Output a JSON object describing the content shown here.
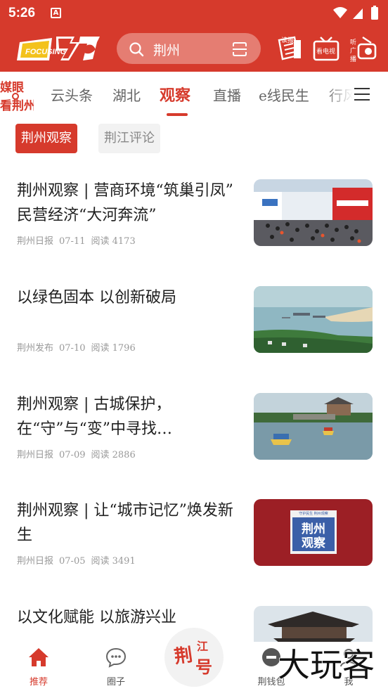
{
  "status_bar": {
    "time": "5:26",
    "app_badge": "A"
  },
  "header": {
    "logo_text": "FOCUSING",
    "search": {
      "value": "荆州"
    },
    "icons": [
      {
        "name": "newspaper-icon",
        "label": "读报"
      },
      {
        "name": "tv-icon",
        "label": "看电视"
      },
      {
        "name": "radio-icon",
        "label": "听广播"
      }
    ]
  },
  "channels": {
    "badge": "媒眼看荆州",
    "tabs": [
      "云头条",
      "湖北",
      "观察",
      "直播",
      "e线民生",
      "行风"
    ],
    "active_index": 2
  },
  "subtabs": [
    "荆州观察",
    "荆江评论"
  ],
  "articles": [
    {
      "title": "荆州观察 | 营商环境“筑巢引凤” 民营经济“大河奔流”",
      "source": "荆州日报",
      "date": "07-11",
      "reads": "阅读 4173",
      "image": "trade-fair-photo"
    },
    {
      "title": "以绿色固本 以创新破局",
      "source": "荆州发布",
      "date": "07-10",
      "reads": "阅读 1796",
      "image": "river-aerial-photo"
    },
    {
      "title": "荆州观察 | 古城保护，在“守”与“变”中寻找…",
      "source": "荆州日报",
      "date": "07-09",
      "reads": "阅读 2886",
      "image": "ancient-city-moat-photo"
    },
    {
      "title": "荆州观察 | 让“城市记忆”焕发新生",
      "source": "荆州日报",
      "date": "07-05",
      "reads": "阅读 3491",
      "image": "jingzhou-observation-cover",
      "image_caption": "荆州观察",
      "image_small": "守护民生 荆州观察"
    },
    {
      "title": "以文化赋能 以旅游兴业",
      "source": "",
      "date": "",
      "reads": "",
      "image": "city-gate-tower-photo"
    }
  ],
  "bottom_nav": {
    "items": [
      {
        "label": "推荐",
        "icon": "home-icon"
      },
      {
        "label": "圈子",
        "icon": "chat-bubble-icon"
      },
      {
        "label": "荆钱包",
        "icon": "wallet-icon"
      },
      {
        "label": "我",
        "icon": "user-icon"
      }
    ],
    "center_label": "荆江号",
    "active_index": 0
  },
  "watermark": "大玩客",
  "colors": {
    "brand_red": "#d63a2c",
    "search_bg": "#e57d72",
    "meta_gray": "#999999"
  }
}
